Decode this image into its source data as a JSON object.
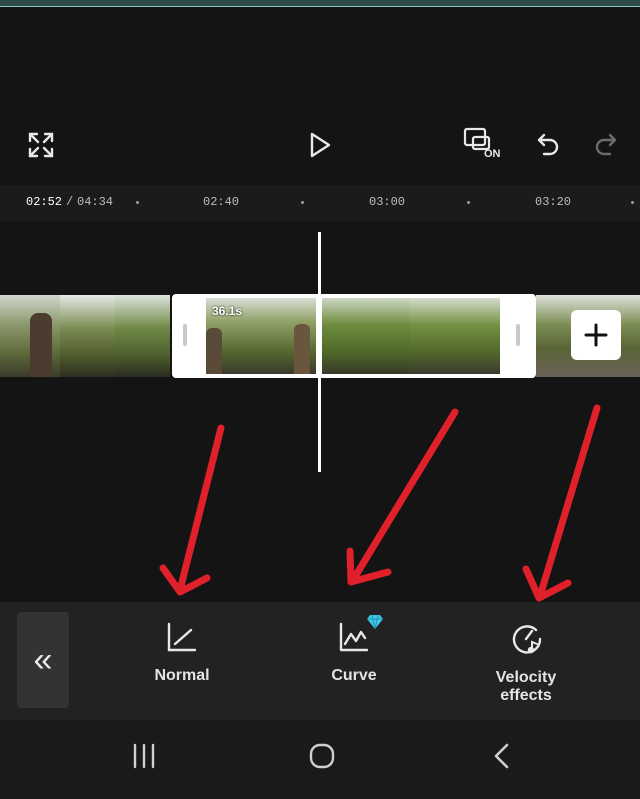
{
  "preview": {
    "label": ""
  },
  "controls": {
    "fullscreen_icon": "fullscreen-icon",
    "play_icon": "play-icon",
    "keyframe_toggle_icon": "keyframe-toggle-icon",
    "keyframe_toggle_badge": "ON",
    "undo_icon": "undo-icon",
    "redo_icon": "redo-icon"
  },
  "ruler": {
    "current_time": "02:52",
    "separator": "/",
    "total_time": "04:34",
    "ticks": [
      "02:40",
      "03:00",
      "03:20"
    ]
  },
  "timeline": {
    "selected_clip_duration": "36.1s",
    "add_clip_label": "+"
  },
  "toolbar": {
    "collapse_label": "«",
    "items": [
      {
        "label": "Normal",
        "icon": "normal-speed-icon"
      },
      {
        "label": "Curve",
        "icon": "curve-speed-icon",
        "badge": "premium-diamond-icon"
      },
      {
        "label": "Velocity\neffects",
        "icon": "velocity-effects-icon"
      }
    ]
  },
  "navbar": {
    "recents_icon": "recents-icon",
    "home_icon": "home-icon",
    "back_icon": "back-icon"
  },
  "colors": {
    "background": "#141414",
    "toolbar": "#222222",
    "arrow": "#e0202a",
    "premium": "#3ec7e6"
  }
}
